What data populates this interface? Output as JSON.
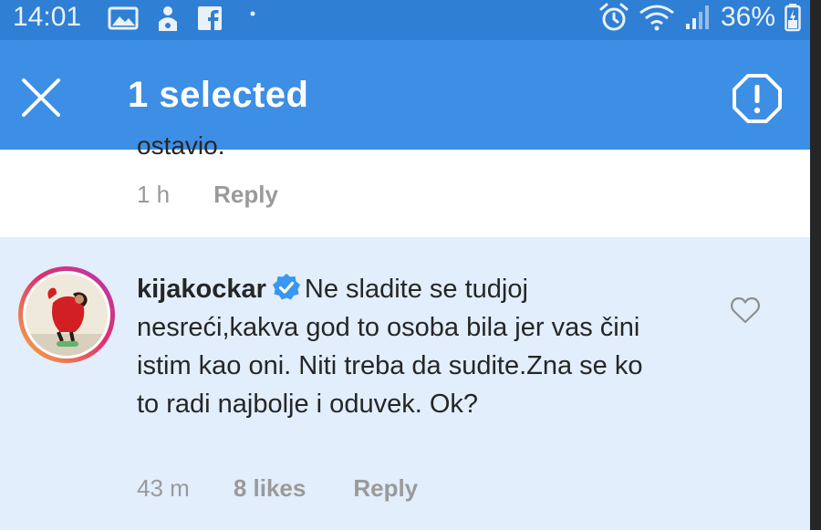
{
  "status_bar": {
    "time": "14:01",
    "battery_percent": "36%",
    "left_icons": [
      "gallery-icon",
      "person-notification-icon",
      "facebook-icon",
      "dot-icon"
    ],
    "right_icons": [
      "alarm-icon",
      "wifi-icon",
      "signal-icon",
      "battery-icon"
    ]
  },
  "action_bar": {
    "title": "1 selected",
    "close_icon": "close-icon",
    "report_icon": "report-icon"
  },
  "previous_comment": {
    "clipped_text": "ostavio.",
    "time": "1 h",
    "reply_label": "Reply"
  },
  "selected_comment": {
    "username": "kijakockar",
    "verified": true,
    "text": "Ne sladite se tudjoj nesreći,kakva god to osoba bila jer vas čini istim kao oni. Niti treba da sudite.Zna se ko to radi najbolje i oduvek. Ok?",
    "time": "43 m",
    "likes": "8 likes",
    "reply_label": "Reply",
    "like_icon": "heart-outline-icon"
  },
  "colors": {
    "action_bar": "#3d8ee5",
    "status_bar": "#2f7fd4",
    "selected_background": "#e2eefb",
    "verified_badge": "#3897f0",
    "meta_text": "#9a9a9a"
  }
}
